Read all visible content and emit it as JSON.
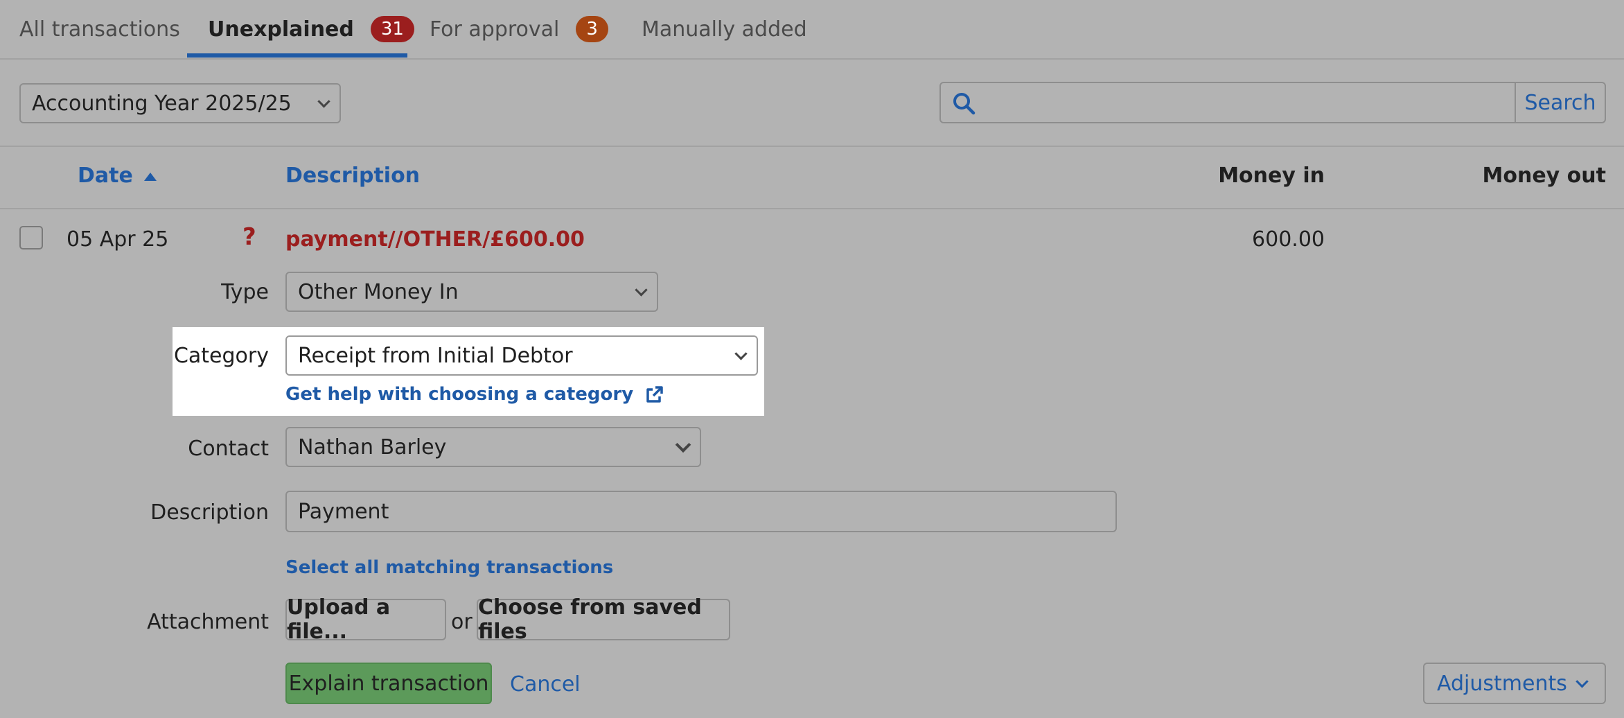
{
  "tabs": [
    {
      "label": "All transactions"
    },
    {
      "label": "Unexplained",
      "badge": "31"
    },
    {
      "label": "For approval",
      "badge": "3"
    },
    {
      "label": "Manually added"
    }
  ],
  "filter": {
    "year_selected": "Accounting Year 2025/25"
  },
  "search": {
    "button_label": "Search",
    "value": ""
  },
  "table": {
    "headers": {
      "date": "Date",
      "description": "Description",
      "money_in": "Money in",
      "money_out": "Money out"
    },
    "row": {
      "date": "05 Apr 25",
      "status_icon": "?",
      "description": "payment//OTHER/£600.00",
      "money_in": "600.00",
      "money_out": ""
    }
  },
  "form": {
    "type_label": "Type",
    "type_value": "Other Money In",
    "category_label": "Category",
    "category_value": "Receipt from Initial Debtor",
    "category_help": "Get help with choosing a category",
    "contact_label": "Contact",
    "contact_value": "Nathan Barley",
    "description_label": "Description",
    "description_value": "Payment",
    "select_matching": "Select all matching transactions",
    "attachment_label": "Attachment",
    "upload_label": "Upload a file...",
    "or_text": "or",
    "choose_saved_label": "Choose from saved files",
    "explain_label": "Explain transaction",
    "cancel_label": "Cancel",
    "adjustments_label": "Adjustments"
  },
  "colors": {
    "accent": "#1f5aa6",
    "error": "#9b1e1e",
    "success": "#5c9a5a"
  }
}
